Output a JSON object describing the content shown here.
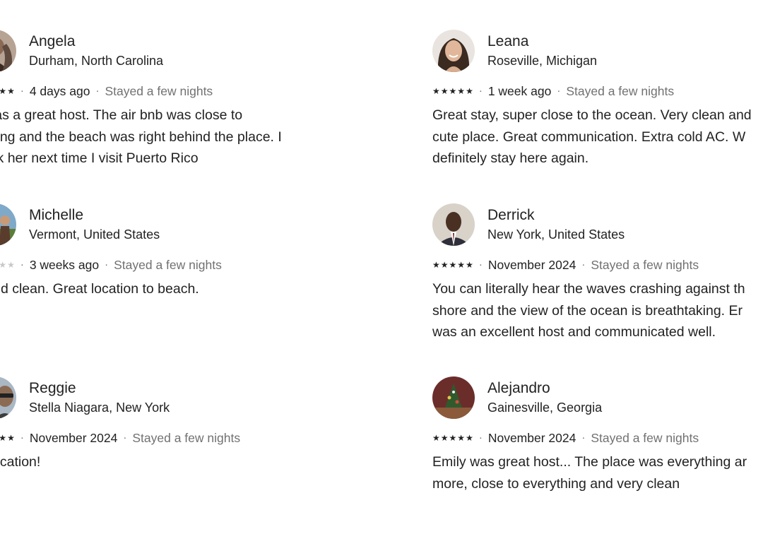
{
  "reviews": [
    {
      "name": "Angela",
      "location": "Durham, North Carolina",
      "rating": 5,
      "time": "4 days ago",
      "stay": "Stayed a few nights",
      "lines": [
        "y was a great host. The air bnb was close to",
        "rything and the beach was right behind the place. I",
        "book her next time I visit Puerto Rico"
      ]
    },
    {
      "name": "Leana",
      "location": "Roseville, Michigan",
      "rating": 5,
      "time": "1 week ago",
      "stay": "Stayed a few nights",
      "lines": [
        "Great stay, super close to the ocean. Very clean and",
        "cute place. Great communication. Extra cold AC. W",
        "definitely stay here again."
      ]
    },
    {
      "name": "Michelle",
      "location": "Vermont, United States",
      "rating": 3,
      "time": "3 weeks ago",
      "stay": "Stayed a few nights",
      "lines": [
        "e and clean. Great location to beach."
      ]
    },
    {
      "name": "Derrick",
      "location": "New York, United States",
      "rating": 5,
      "time": "November 2024",
      "stay": "Stayed a few nights",
      "lines": [
        "You can literally hear the waves crashing against th",
        "shore and the view of the ocean is breathtaking. Er",
        "was an excellent host and communicated well."
      ]
    },
    {
      "name": "Reggie",
      "location": "Stella Niagara, New York",
      "rating": 5,
      "time": "November 2024",
      "stay": "Stayed a few nights",
      "lines": [
        "at location!"
      ]
    },
    {
      "name": "Alejandro",
      "location": "Gainesville, Georgia",
      "rating": 5,
      "time": "November 2024",
      "stay": "Stayed a few nights",
      "lines": [
        "Emily was great host... The place was everything ar",
        "more, close to everything and very clean"
      ]
    }
  ],
  "colors": {
    "primary_text": "#222222",
    "secondary_text": "#717171",
    "star_filled": "#222222",
    "star_empty": "#c8c8c8"
  }
}
